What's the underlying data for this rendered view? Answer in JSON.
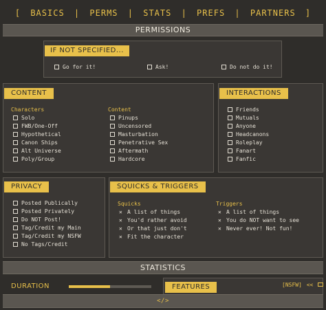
{
  "nav": {
    "open": "[",
    "close": "]",
    "sep": "|",
    "items": [
      "BASICS",
      "PERMS",
      "STATS",
      "PREFS",
      "PARTNERS"
    ]
  },
  "permissions": {
    "title": "PERMISSIONS",
    "if_not_specified": {
      "tag": "IF NOT SPECIFIED...",
      "options": [
        "Go for it!",
        "Ask!",
        "Do not do it!"
      ]
    }
  },
  "content": {
    "tag": "CONTENT",
    "characters": {
      "label": "Characters",
      "items": [
        "Solo",
        "FWB/One-Off",
        "Hypothetical",
        "Canon Ships",
        "Alt Universe",
        "Poly/Group"
      ]
    },
    "content_col": {
      "label": "Content",
      "items": [
        "Pinups",
        "Uncensored",
        "Masturbation",
        "Penetrative Sex",
        "Aftermath",
        "Hardcore"
      ]
    }
  },
  "interactions": {
    "tag": "INTERACTIONS",
    "items": [
      "Friends",
      "Mutuals",
      "Anyone",
      "Headcanons",
      "Roleplay",
      "Fanart",
      "Fanfic"
    ]
  },
  "privacy": {
    "tag": "PRIVACY",
    "items": [
      "Posted Publically",
      "Posted Privately",
      "Do NOT Post!",
      "Tag/Credit my Main",
      "Tag/Credit my NSFW",
      "No Tags/Credit"
    ]
  },
  "squicks_triggers": {
    "tag": "SQUICKS & TRIGGERS",
    "mark": "✕",
    "squicks": {
      "label": "Squicks",
      "items": [
        "A list of things",
        "You'd rather avoid",
        "Or that just don't",
        "Fit the character"
      ]
    },
    "triggers": {
      "label": "Triggers",
      "items": [
        "A list of things",
        "You do NOT want to see",
        "Never ever! Not fun!"
      ]
    }
  },
  "statistics": {
    "title": "STATISTICS",
    "duration_label": "DURATION",
    "duration_fraction": 0.5,
    "features_tag": "FEATURES",
    "nsfw_label": "[NSFW]",
    "back_label": "<<",
    "bottom_icon": "</>"
  },
  "colors": {
    "accent": "#e8c04a",
    "background": "#2f2d2a",
    "panel": "#3a3734",
    "bar": "#5a5650"
  }
}
